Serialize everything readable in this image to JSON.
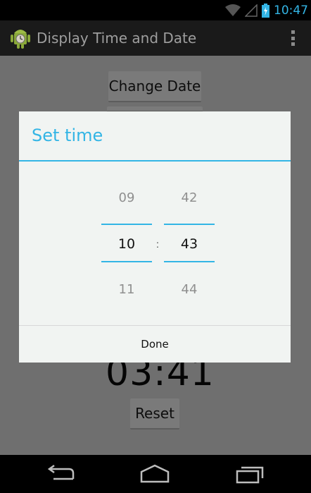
{
  "status_bar": {
    "time": "10:47"
  },
  "action_bar": {
    "title": "Display Time and Date"
  },
  "main": {
    "change_date_label": "Change Date",
    "clock_text": "03:41",
    "reset_label": "Reset"
  },
  "dialog": {
    "title": "Set time",
    "hours": {
      "prev": "09",
      "current": "10",
      "next": "11"
    },
    "minutes": {
      "prev": "42",
      "current": "43",
      "next": "44"
    },
    "separator": ":",
    "done_label": "Done"
  },
  "colors": {
    "accent": "#33b5e5",
    "dialog_bg": "#f1f4f2",
    "dim_overlay": "#6f6f6f"
  },
  "icons": [
    "wifi-icon",
    "cell-signal-icon",
    "battery-charging-icon",
    "android-app-icon",
    "overflow-menu-icon",
    "back-icon",
    "home-icon",
    "recents-icon"
  ]
}
